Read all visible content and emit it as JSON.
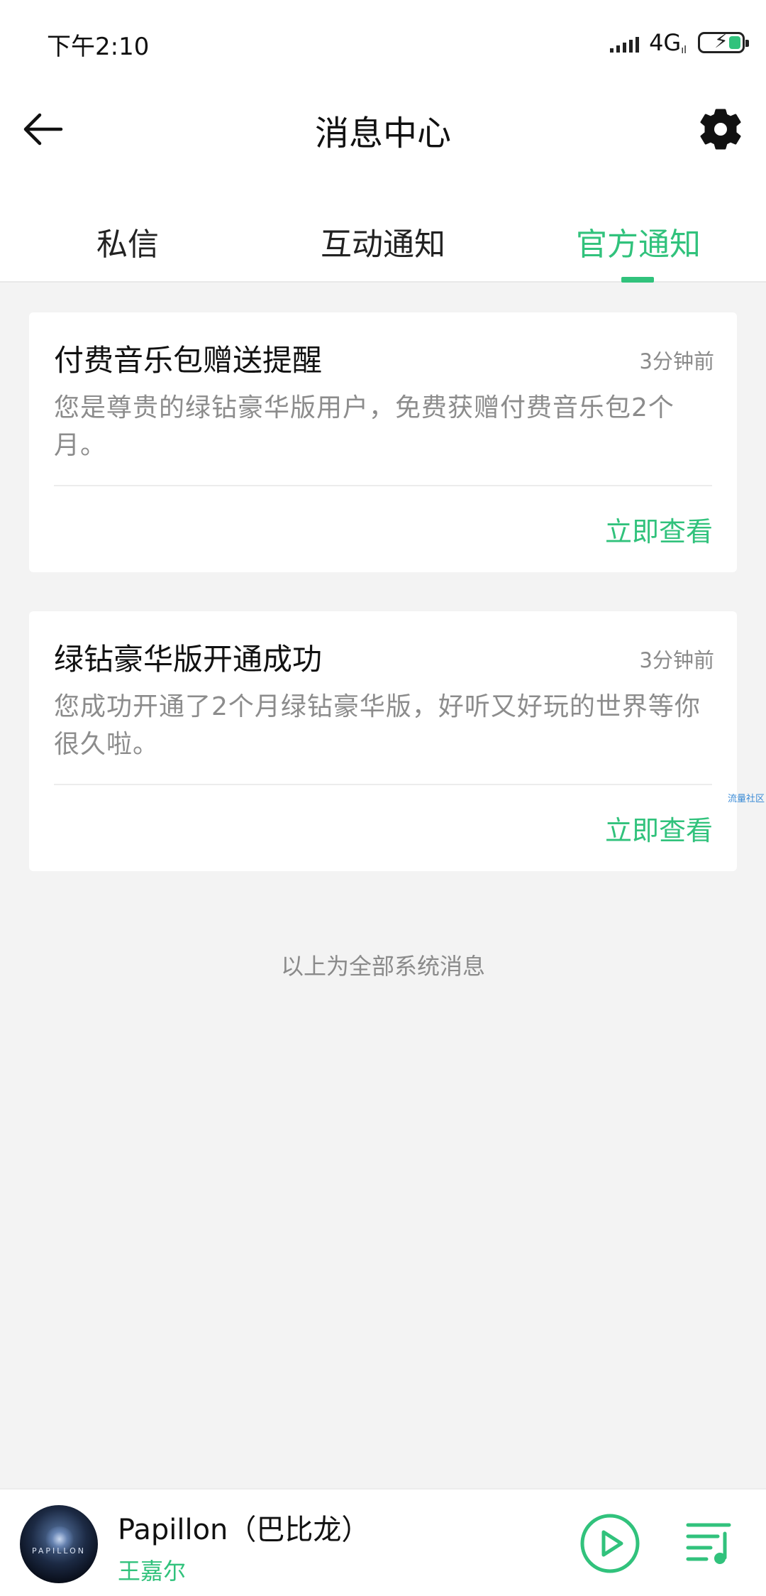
{
  "status_bar": {
    "time": "下午2:10",
    "network": "4G",
    "network_sub": "ıl"
  },
  "header": {
    "title": "消息中心",
    "back_icon": "arrow-left-icon",
    "settings_icon": "gear-icon"
  },
  "tabs": [
    {
      "label": "私信",
      "active": false
    },
    {
      "label": "互动通知",
      "active": false
    },
    {
      "label": "官方通知",
      "active": true
    }
  ],
  "messages": [
    {
      "title": "付费音乐包赠送提醒",
      "time": "3分钟前",
      "body": "您是尊贵的绿钻豪华版用户，免费获赠付费音乐包2个月。",
      "action": "立即查看"
    },
    {
      "title": "绿钻豪华版开通成功",
      "time": "3分钟前",
      "body": "您成功开通了2个月绿钻豪华版，好听又好玩的世界等你很久啦。",
      "action": "立即查看"
    }
  ],
  "watermark": "流量社区",
  "footer_note": "以上为全部系统消息",
  "player": {
    "song_title": "Papillon（巴比龙）",
    "artist": "王嘉尔",
    "album_text": "PAPILLON",
    "play_icon": "play-circle-icon",
    "playlist_icon": "playlist-icon"
  },
  "colors": {
    "accent": "#31c27c",
    "background": "#f3f3f3"
  }
}
